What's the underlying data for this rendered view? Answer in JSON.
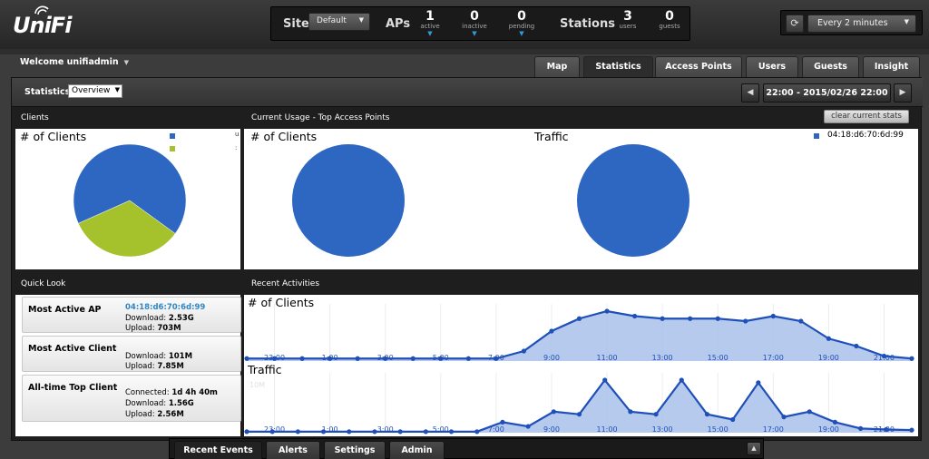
{
  "app": {
    "logo": "UniFi"
  },
  "summary": {
    "site_label": "Site",
    "site_value": "Default",
    "aps_label": "APs",
    "aps": [
      {
        "num": "1",
        "sub": "active"
      },
      {
        "num": "0",
        "sub": "inactive"
      },
      {
        "num": "0",
        "sub": "pending"
      }
    ],
    "stations_label": "Stations",
    "stations": [
      {
        "num": "3",
        "sub": "users"
      },
      {
        "num": "0",
        "sub": "guests"
      }
    ]
  },
  "refresh": {
    "icon": "refresh-icon",
    "value": "Every 2 minutes"
  },
  "welcome": "Welcome unifiadmin",
  "tabs": [
    {
      "label": "Map"
    },
    {
      "label": "Statistics",
      "active": true
    },
    {
      "label": "Access Points"
    },
    {
      "label": "Users"
    },
    {
      "label": "Guests"
    },
    {
      "label": "Insight"
    }
  ],
  "stats": {
    "label": "Statistics",
    "view": "Overview",
    "prev_icon": "chevron-left-icon",
    "next_icon": "chevron-right-icon",
    "daterange": "22:00 - 2015/02/26 22:00"
  },
  "clients_panel": {
    "header": "Clients",
    "title": "# of Clients",
    "legend_partial": "u",
    "pie": [
      {
        "value": 2,
        "color": "#2e67c2"
      },
      {
        "value": 1,
        "color": "#a5c12b"
      }
    ]
  },
  "usage_panel": {
    "header": "Current Usage - Top Access Points",
    "clear_label": "clear current stats",
    "left_title": "# of Clients",
    "right_title": "Traffic",
    "legend": "04:18:d6:70:6d:99",
    "color": "#2e67c2"
  },
  "quicklook": {
    "header": "Quick Look",
    "items": [
      {
        "title": "Most Active AP",
        "ap": "04:18:d6:70:6d:99",
        "lines": [
          {
            "label": "Download:",
            "value": "2.53G"
          },
          {
            "label": "Upload:",
            "value": "703M"
          }
        ]
      },
      {
        "title": "Most Active Client",
        "lines": [
          {
            "label": "Download:",
            "value": "101M"
          },
          {
            "label": "Upload:",
            "value": "7.85M"
          }
        ]
      },
      {
        "title": "All-time Top Client",
        "lines": [
          {
            "label": "Connected:",
            "value": "1d 4h 40m"
          },
          {
            "label": "Download:",
            "value": "1.56G"
          },
          {
            "label": "Upload:",
            "value": "2.56M"
          }
        ]
      }
    ]
  },
  "recent": {
    "header": "Recent Activities",
    "clients_title": "# of Clients",
    "traffic_title": "Traffic",
    "traffic_ytick": "10M"
  },
  "chart_data": [
    {
      "type": "area",
      "title": "# of Clients",
      "x": [
        "22:00",
        "23:00",
        "0:00",
        "1:00",
        "2:00",
        "3:00",
        "4:00",
        "5:00",
        "6:00",
        "7:00",
        "8:00",
        "9:00",
        "10:00",
        "11:00",
        "12:00",
        "13:00",
        "14:00",
        "15:00",
        "16:00",
        "17:00",
        "18:00",
        "19:00",
        "20:00",
        "21:00",
        "22:00"
      ],
      "tick_labels": [
        "23:00",
        "1:00",
        "3:00",
        "5:00",
        "7:00",
        "9:00",
        "11:00",
        "13:00",
        "15:00",
        "17:00",
        "19:00",
        "21:00"
      ],
      "values": [
        0.05,
        0.05,
        0.05,
        0.05,
        0.05,
        0.05,
        0.05,
        0.05,
        0.05,
        0.05,
        0.2,
        0.6,
        0.85,
        1.0,
        0.9,
        0.85,
        0.85,
        0.85,
        0.8,
        0.9,
        0.8,
        0.45,
        0.3,
        0.1,
        0.05
      ],
      "color": "#1f4fb8",
      "fill": "#a9c1ea"
    },
    {
      "type": "area",
      "title": "Traffic",
      "x": [
        "22:00",
        "23:00",
        "0:00",
        "1:00",
        "2:00",
        "3:00",
        "4:00",
        "5:00",
        "6:00",
        "7:00",
        "8:00",
        "9:00",
        "10:00",
        "11:00",
        "12:00",
        "13:00",
        "14:00",
        "15:00",
        "16:00",
        "17:00",
        "18:00",
        "19:00",
        "20:00",
        "21:00",
        "22:00"
      ],
      "tick_labels": [
        "23:00",
        "1:00",
        "3:00",
        "5:00",
        "7:00",
        "9:00",
        "11:00",
        "13:00",
        "15:00",
        "17:00",
        "19:00",
        "21:00"
      ],
      "values": [
        0.02,
        0.02,
        0.02,
        0.02,
        0.02,
        0.02,
        0.02,
        0.02,
        0.02,
        0.02,
        0.2,
        0.12,
        0.4,
        0.35,
        1.0,
        0.4,
        0.35,
        1.0,
        0.35,
        0.25,
        0.95,
        0.3,
        0.4,
        0.2,
        0.08,
        0.06,
        0.05
      ],
      "color": "#1f4fb8",
      "fill": "#a9c1ea"
    }
  ],
  "bottom": {
    "tabs": [
      {
        "label": "Recent Events",
        "active": true
      },
      {
        "label": "Alerts"
      },
      {
        "label": "Settings"
      },
      {
        "label": "Admin"
      }
    ],
    "collapse_icon": "chevron-up-icon"
  }
}
